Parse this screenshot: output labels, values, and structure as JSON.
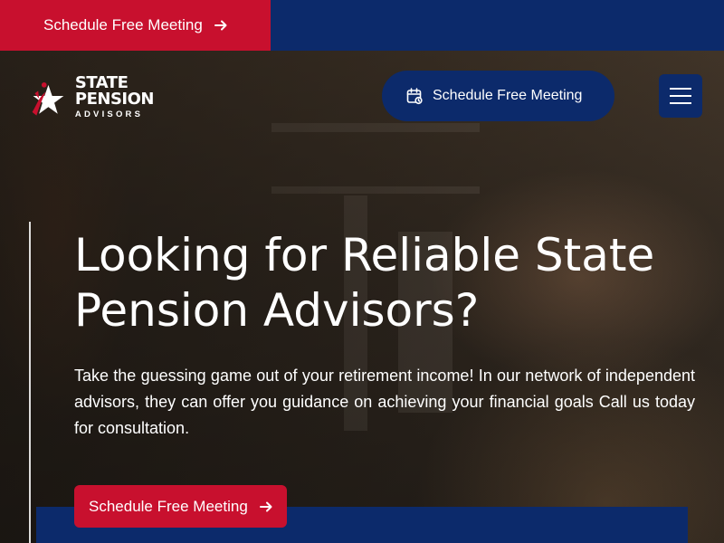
{
  "topbar": {
    "cta_label": "Schedule Free Meeting",
    "cta_icon": "arrow-right-icon"
  },
  "header": {
    "logo": {
      "line1": "STATE",
      "line2": "PENSION",
      "line3": "ADVISORS"
    },
    "cta_label": "Schedule Free Meeting",
    "cta_icon": "calendar-icon",
    "menu_icon": "hamburger-menu-icon"
  },
  "hero": {
    "headline": "Looking for Reliable State Pension Advisors?",
    "body": "Take the guessing game out of your retirement income! In our network of independent advisors, they can offer you guidance on achieving your financial goals Call us today for consultation.",
    "cta_label": "Schedule Free Meeting",
    "cta_icon": "arrow-right-icon"
  },
  "colors": {
    "brand_red": "#c8102e",
    "brand_navy": "#0c2a6b",
    "text": "#ffffff"
  }
}
